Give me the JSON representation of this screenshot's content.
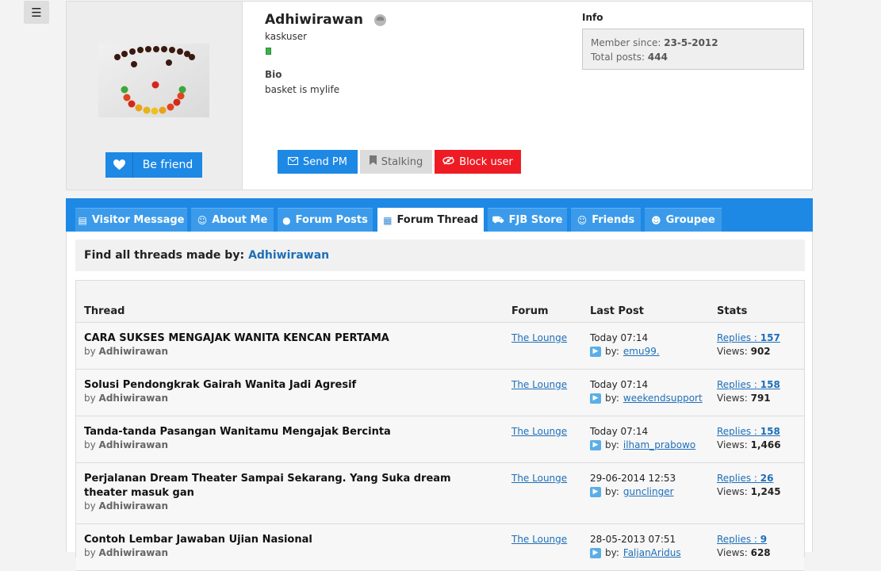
{
  "menu": {
    "icon": "hamburger-icon",
    "glyph": "☰"
  },
  "profile": {
    "username": "Adhiwirawan",
    "rank": "kaskuser",
    "bio_title": "Bio",
    "bio": "basket is mylife",
    "befriend_label": "Be friend",
    "buttons": {
      "send_pm": "Send PM",
      "stalking": "Stalking",
      "block": "Block user"
    },
    "info_title": "Info",
    "member_since_label": "Member since:",
    "member_since": "23-5-2012",
    "total_posts_label": "Total posts:",
    "total_posts": "444"
  },
  "tabs": [
    {
      "label": "Visitor Message",
      "icon": "message-icon"
    },
    {
      "label": "About Me",
      "icon": "user-icon"
    },
    {
      "label": "Forum Posts",
      "icon": "chat-icon"
    },
    {
      "label": "Forum Thread",
      "icon": "calendar-icon",
      "active": true
    },
    {
      "label": "FJB Store",
      "icon": "cart-icon"
    },
    {
      "label": "Friends",
      "icon": "friends-icon"
    },
    {
      "label": "Groupee",
      "icon": "group-icon"
    }
  ],
  "find": {
    "label": "Find all threads made by:",
    "user": "Adhiwirawan"
  },
  "table": {
    "headers": {
      "thread": "Thread",
      "forum": "Forum",
      "last_post": "Last Post",
      "stats": "Stats"
    },
    "by_label": "by",
    "lp_by_label": "by:",
    "replies_label": "Replies :",
    "views_label": "Views:",
    "rows": [
      {
        "title": "CARA SUKSES MENGAJAK WANITA KENCAN PERTAMA",
        "author": "Adhiwirawan",
        "forum": "The Lounge",
        "last_post": "Today 07:14",
        "last_by": "emu99.",
        "replies": "157",
        "views": "902"
      },
      {
        "title": "Solusi Pendongkrak Gairah Wanita Jadi Agresif",
        "author": "Adhiwirawan",
        "forum": "The Lounge",
        "last_post": "Today 07:14",
        "last_by": "weekendsupport",
        "replies": "158",
        "views": "791"
      },
      {
        "title": "Tanda-tanda Pasangan Wanitamu Mengajak Bercinta",
        "author": "Adhiwirawan",
        "forum": "The Lounge",
        "last_post": "Today 07:14",
        "last_by": "ilham_prabowo",
        "replies": "158",
        "views": "1,466"
      },
      {
        "title": "Perjalanan Dream Theater Sampai Sekarang. Yang Suka dream theater masuk gan",
        "author": "Adhiwirawan",
        "forum": "The Lounge",
        "last_post": "29-06-2014 12:53",
        "last_by": "gunclinger",
        "replies": "26",
        "views": "1,245"
      },
      {
        "title": "Contoh Lembar Jawaban Ujian Nasional",
        "author": "Adhiwirawan",
        "forum": "The Lounge",
        "last_post": "28-05-2013 07:51",
        "last_by": "FaljanAridus",
        "replies": "9",
        "views": "628"
      }
    ]
  }
}
